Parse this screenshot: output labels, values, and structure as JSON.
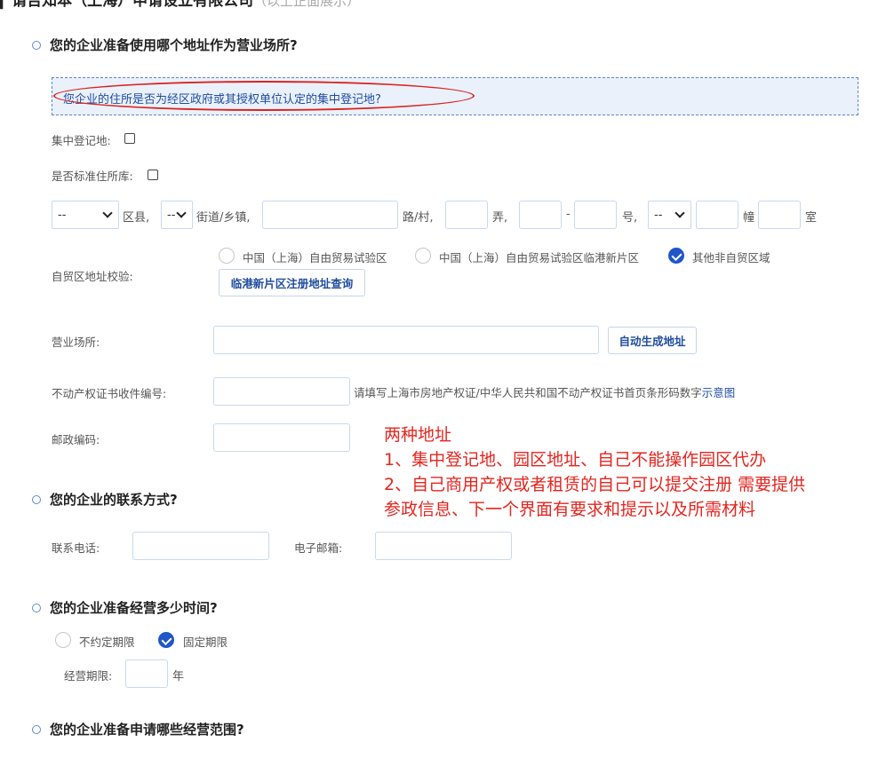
{
  "top_cut": {
    "title": "▎请告知本（上海）申请设立有限公司",
    "hint": "（以上正面展示）"
  },
  "q1": {
    "title": "您的企业准备使用哪个地址作为营业场所?"
  },
  "notice": {
    "text": "您企业的住所是否为经区政府或其授权单位认定的集中登记地?"
  },
  "central_reg": {
    "label": "集中登记地:"
  },
  "std_lib": {
    "label": "是否标准住所库:"
  },
  "address": {
    "district_select": "--",
    "district_suffix": "区县,",
    "street_select": "--",
    "street_suffix": "街道/乡镇,",
    "road_value": "",
    "road_suffix": "路/村,",
    "lane_suffix": "弄,",
    "dash": "-",
    "num_suffix": "号,",
    "bldg_select": "--",
    "bldg_suffix": "幢",
    "room_suffix": "室"
  },
  "ftz": {
    "label": "自贸区地址校验:",
    "options": [
      "中国（上海）自由贸易试验区",
      "中国（上海）自由贸易试验区临港新片区",
      "其他非自贸区域"
    ],
    "selected": "其他非自贸区域",
    "query_button": "临港新片区注册地址查询"
  },
  "business_place": {
    "label": "营业场所:",
    "value": "",
    "auto_button": "自动生成地址"
  },
  "property_cert": {
    "label": "不动产权证书收件编号:",
    "value": "",
    "hint": "请填写上海市房地产权证/中华人民共和国不动产权证书首页条形码数字",
    "hint_link": "示意图"
  },
  "postcode": {
    "label": "邮政编码:",
    "value": ""
  },
  "q2": {
    "title": "您的企业的联系方式?"
  },
  "contact": {
    "phone_label": "联系电话:",
    "phone_value": "",
    "email_label": "电子邮箱:",
    "email_value": ""
  },
  "q3": {
    "title": "您的企业准备经营多少时间?"
  },
  "term": {
    "options": [
      "不约定期限",
      "固定期限"
    ],
    "selected": "固定期限",
    "period_label": "经营期限:",
    "period_value": "",
    "period_unit": "年"
  },
  "q4": {
    "title": "您的企业准备申请哪些经营范围?"
  },
  "annotation": {
    "lines": [
      "两种地址",
      "1、集中登记地、园区地址、自己不能操作园区代办",
      "2、自己商用产权或者租赁的自己可以提交注册 需要提供",
      "参政信息、下一个界面有要求和提示以及所需材料"
    ]
  },
  "colors": {
    "accent": "#1f56c8",
    "annotation_red": "#e3261f",
    "notice_bg": "#eaf1fb"
  }
}
